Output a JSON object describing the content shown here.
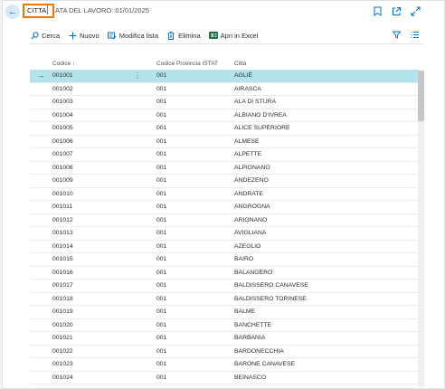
{
  "header": {
    "title": "CITTA",
    "subtitle": "ATA DEL LAVORO: 01/01/2025",
    "icons": [
      "back-arrow-icon",
      "bookmark-icon",
      "open-new-window-icon",
      "expand-icon"
    ]
  },
  "toolbar": {
    "search_label": "Cerca",
    "new_label": "Nuovo",
    "edit_list_label": "Modifica lista",
    "delete_label": "Elimina",
    "excel_label": "Apri in Excel",
    "right_icons": [
      "filter-icon",
      "list-options-icon"
    ]
  },
  "table": {
    "columns": [
      "Codice ↑",
      "Codice Provincia ISTAT",
      "Città"
    ],
    "selected_row_index": 0,
    "rows": [
      {
        "code": "001001",
        "prov": "001",
        "city": "AGLIÈ"
      },
      {
        "code": "001002",
        "prov": "001",
        "city": "AIRASCA"
      },
      {
        "code": "001003",
        "prov": "001",
        "city": "ALA DI STURA"
      },
      {
        "code": "001004",
        "prov": "001",
        "city": "ALBIANO D'IVREA"
      },
      {
        "code": "001005",
        "prov": "001",
        "city": "ALICE SUPERIORE"
      },
      {
        "code": "001006",
        "prov": "001",
        "city": "ALMESE"
      },
      {
        "code": "001007",
        "prov": "001",
        "city": "ALPETTE"
      },
      {
        "code": "001008",
        "prov": "001",
        "city": "ALPIGNANO"
      },
      {
        "code": "001009",
        "prov": "001",
        "city": "ANDEZENO"
      },
      {
        "code": "001010",
        "prov": "001",
        "city": "ANDRATE"
      },
      {
        "code": "001011",
        "prov": "001",
        "city": "ANGROGNA"
      },
      {
        "code": "001012",
        "prov": "001",
        "city": "ARIGNANO"
      },
      {
        "code": "001013",
        "prov": "001",
        "city": "AVIGLIANA"
      },
      {
        "code": "001014",
        "prov": "001",
        "city": "AZEGLIO"
      },
      {
        "code": "001015",
        "prov": "001",
        "city": "BAIRO"
      },
      {
        "code": "001016",
        "prov": "001",
        "city": "BALANGERO"
      },
      {
        "code": "001017",
        "prov": "001",
        "city": "BALDISSERO CANAVESE"
      },
      {
        "code": "001018",
        "prov": "001",
        "city": "BALDISSERO TORINESE"
      },
      {
        "code": "001019",
        "prov": "001",
        "city": "BALME"
      },
      {
        "code": "001020",
        "prov": "001",
        "city": "BANCHETTE"
      },
      {
        "code": "001021",
        "prov": "001",
        "city": "BARBANIA"
      },
      {
        "code": "001022",
        "prov": "001",
        "city": "BARDONECCHIA"
      },
      {
        "code": "001023",
        "prov": "001",
        "city": "BARONE CANAVESE"
      },
      {
        "code": "001024",
        "prov": "001",
        "city": "BEINASCO"
      }
    ]
  },
  "colors": {
    "accent": "#006fc9",
    "selected_row": "#b3e4ec",
    "title_highlight": "#f07800",
    "excel_green": "#1e7145"
  }
}
